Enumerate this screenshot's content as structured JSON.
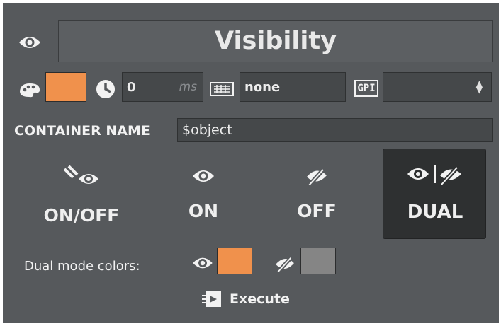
{
  "header": {
    "title": "Visibility"
  },
  "toolbar": {
    "color_swatch": "#f0914c",
    "delay_value": "0",
    "delay_unit": "ms",
    "keyboard_value": "none",
    "gpi_icon_text": "GPI",
    "gpi_value": ""
  },
  "container": {
    "label": "CONTAINER NAME",
    "value": "$object"
  },
  "modes": [
    {
      "label": "ON/OFF",
      "icon": "eye-toggle-icon",
      "selected": false
    },
    {
      "label": "ON",
      "icon": "eye-icon",
      "selected": false
    },
    {
      "label": "OFF",
      "icon": "eye-slash-icon",
      "selected": false
    },
    {
      "label": "DUAL",
      "icon": "eye-dual-icon",
      "selected": true
    }
  ],
  "dual": {
    "label": "Dual mode colors:",
    "on_color": "#f0914c",
    "off_color": "#858585"
  },
  "execute": {
    "label": "Execute"
  }
}
